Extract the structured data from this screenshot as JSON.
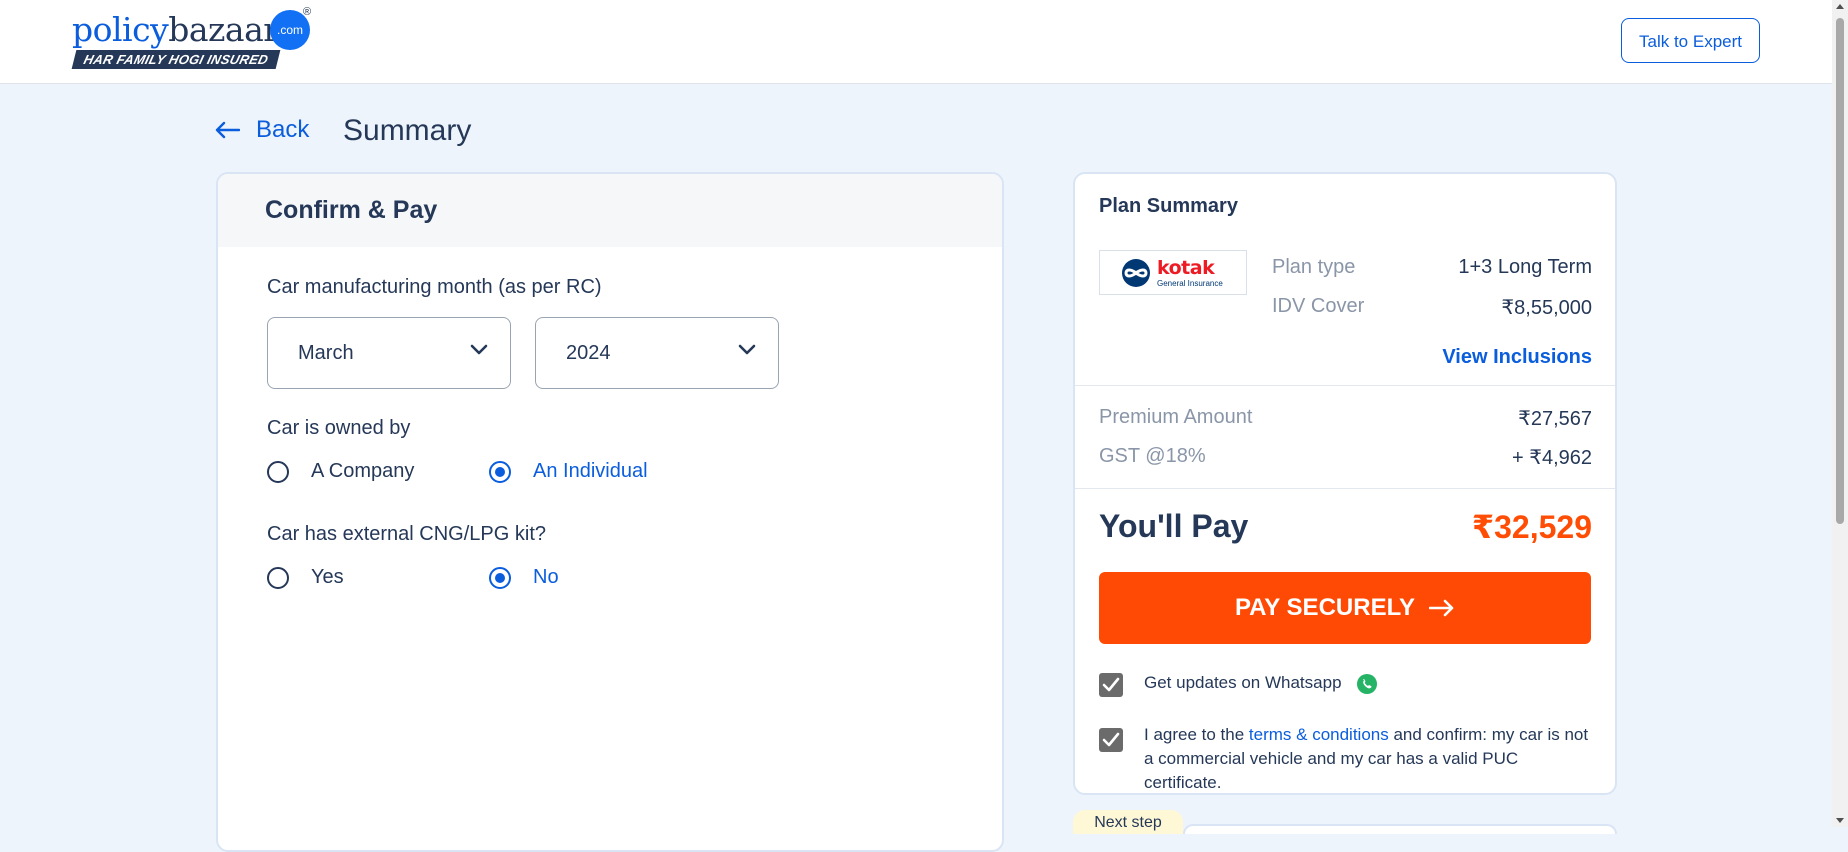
{
  "header": {
    "logo_word_1": "policy",
    "logo_word_2": "bazaar",
    "logo_dot": ".com",
    "logo_reg": "®",
    "logo_tagline": "HAR FAMILY HOGI INSURED",
    "talk_to_expert": "Talk to Expert"
  },
  "nav": {
    "back_label": "Back",
    "page_title": "Summary"
  },
  "form": {
    "card_title": "Confirm & Pay",
    "manufacturing_label": "Car manufacturing month (as per RC)",
    "month_value": "March",
    "year_value": "2024",
    "owned_by_label": "Car is owned by",
    "owned_by_options": [
      "A Company",
      "An Individual"
    ],
    "owned_by_selected": "An Individual",
    "cng_label": "Car has external CNG/LPG kit?",
    "cng_options": [
      "Yes",
      "No"
    ],
    "cng_selected": "No"
  },
  "summary": {
    "title": "Plan Summary",
    "insurer_name": "kotak",
    "insurer_sub": "General Insurance",
    "plan_type_label": "Plan type",
    "plan_type_value": "1+3 Long Term",
    "idv_label": "IDV Cover",
    "idv_value": "₹8,55,000",
    "view_inclusions": "View Inclusions",
    "premium_label": "Premium Amount",
    "premium_value": "₹27,567",
    "gst_label": "GST @18%",
    "gst_value": "+ ₹4,962",
    "you_pay_label": "You'll Pay",
    "you_pay_value": "₹32,529",
    "pay_button": "PAY SECURELY",
    "whatsapp_text": "Get updates on Whatsapp",
    "whatsapp_checked": true,
    "terms_prefix": "I agree to the ",
    "terms_link": "terms & conditions",
    "terms_suffix": " and confirm: my car is not a commercial vehicle and my car has a valid PUC certificate.",
    "terms_checked": true
  },
  "next_step_label": "Next step",
  "colors": {
    "brand_blue": "#0a5ddc",
    "pay_orange": "#ff4a05",
    "text_dark": "#253858",
    "page_bg": "#eef4fb"
  }
}
